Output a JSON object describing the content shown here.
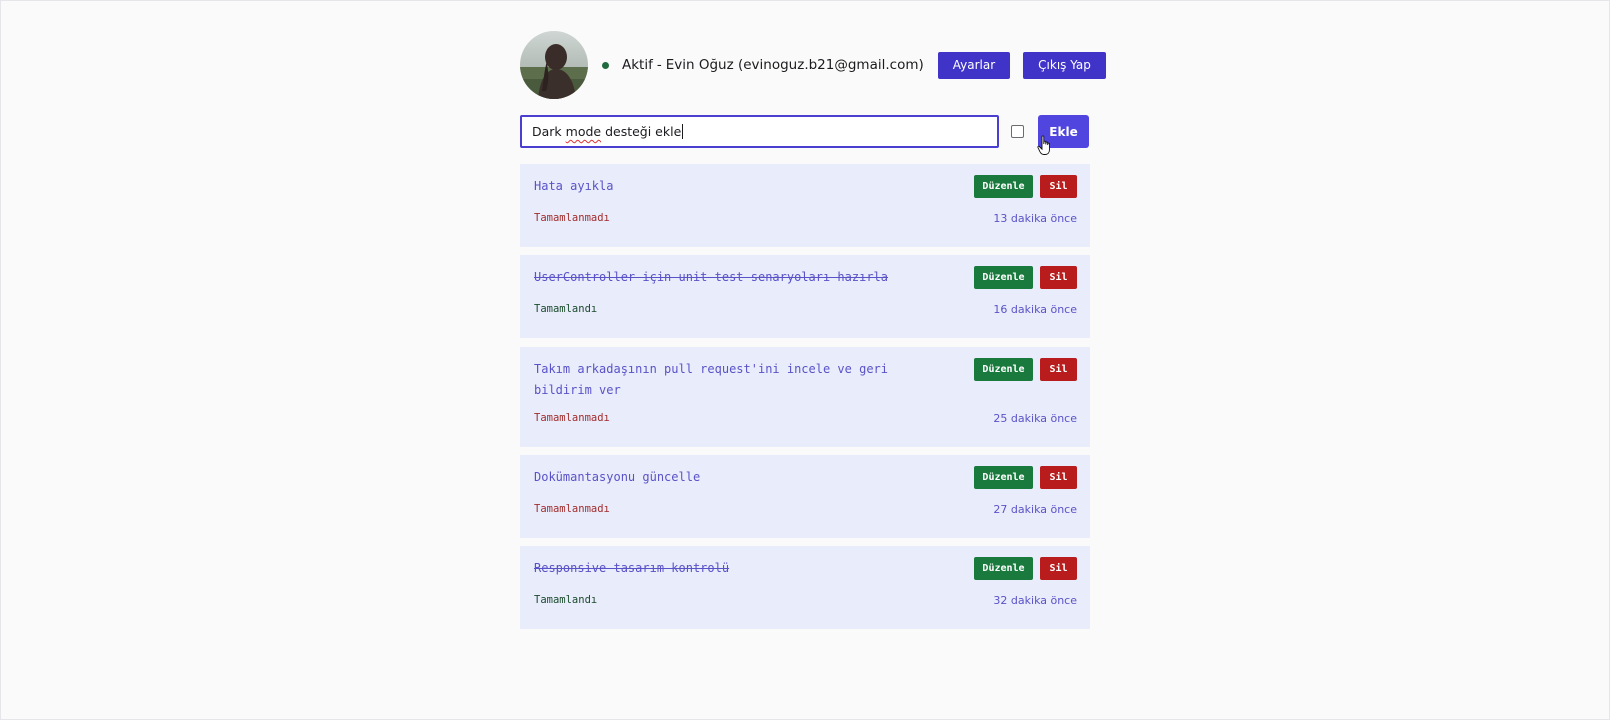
{
  "header": {
    "status": "Aktif",
    "separator": "-",
    "user": "Evin Oğuz (evinoguz.b21@gmail.com)",
    "settings_label": "Ayarlar",
    "logout_label": "Çıkış Yap",
    "status_color": "#1f6b3d",
    "button_color": "#4034c8"
  },
  "add_form": {
    "input_value_prefix": "Dark ",
    "input_value_misspelled": "mode",
    "input_value_suffix": " desteği ekle",
    "completed_checkbox_checked": false,
    "add_label": "Ekle",
    "input_border_color": "#4a3fd0"
  },
  "tasks": [
    {
      "title": "Hata ayıkla",
      "status": "Tamamlanmadı",
      "completed": false,
      "time": "13 dakika önce",
      "edit_label": "Düzenle",
      "delete_label": "Sil"
    },
    {
      "title": "UserController için unit test senaryoları hazırla",
      "status": "Tamamlandı",
      "completed": true,
      "time": "16 dakika önce",
      "edit_label": "Düzenle",
      "delete_label": "Sil"
    },
    {
      "title": "Takım arkadaşının pull request'ini incele ve geri bildirim ver",
      "status": "Tamamlanmadı",
      "completed": false,
      "time": "25 dakika önce",
      "edit_label": "Düzenle",
      "delete_label": "Sil"
    },
    {
      "title": "Dokümantasyonu güncelle",
      "status": "Tamamlanmadı",
      "completed": false,
      "time": "27 dakika önce",
      "edit_label": "Düzenle",
      "delete_label": "Sil"
    },
    {
      "title": "Responsive tasarım kontrolü",
      "status": "Tamamlandı",
      "completed": true,
      "time": "32 dakika önce",
      "edit_label": "Düzenle",
      "delete_label": "Sil"
    }
  ],
  "colors": {
    "task_background": "#e9ecfb",
    "edit_button": "#1a7a3e",
    "delete_button": "#b81c1c",
    "pending_status": "#a12d2d",
    "complete_status": "#1a4a2c",
    "accent": "#5a52c8"
  }
}
